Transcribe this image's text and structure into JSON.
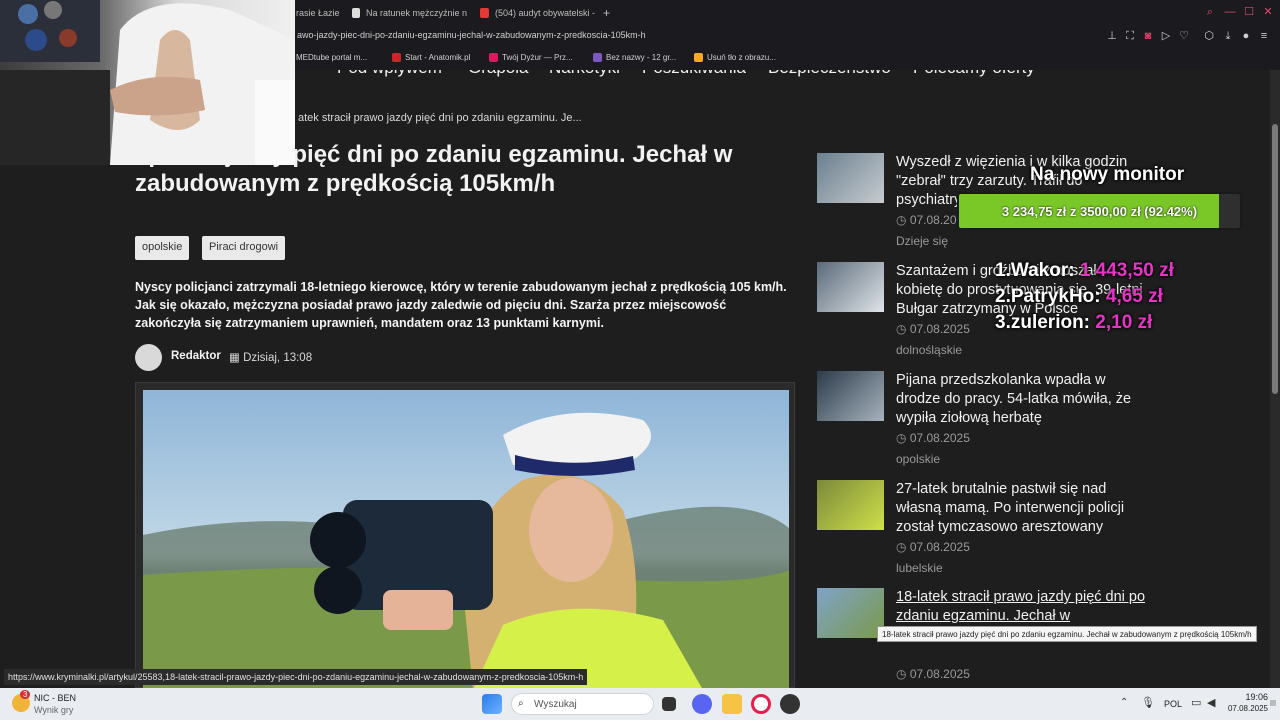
{
  "tabs": [
    {
      "label": "rasie Łazie"
    },
    {
      "label": "Na ratunek mężczyźnie n"
    },
    {
      "label": "(504) audyt obywatelski -"
    }
  ],
  "new_tab": "+",
  "address": {
    "url": "awo-jazdy-piec-dni-po-zdaniu-egzaminu-jechal-w-zabudowanym-z-predkoscia-105km-h"
  },
  "bookmarks": [
    {
      "label": "MEDtube portal m..."
    },
    {
      "label": "Start - Anatomik.pl"
    },
    {
      "label": "Twój Dyżur — Prz..."
    },
    {
      "label": "Bez nazwy - 12 gr..."
    },
    {
      "label": "Usuń tło z obrazu..."
    }
  ],
  "site_nav": [
    "Pod wpływem",
    "Grapola",
    "Narkotyki",
    "Poszukiwania",
    "Bezpieczeństwo",
    "Polecamy oferty"
  ],
  "breadcrumb": "atek stracił prawo jazdy pięć dni po zdaniu egzaminu. Je...",
  "article": {
    "title": "ł prawo jazdy pięć dni po zdaniu egzaminu. Jechał w zabudowanym z prędkością 105km/h",
    "tags": [
      "opolskie",
      "Piraci drogowi"
    ],
    "lead": "Nyscy policjanci zatrzymali 18-letniego kierowcę, który w terenie zabudowanym jechał z prędkością 105 km/h. Jak się okazało, mężczyzna posiadał prawo jazdy zaledwie od pięciu dni. Szarża przez miejscowość zakończyła się zatrzymaniem uprawnień, mandatem oraz 13 punktami karnymi.",
    "author": "Redaktor",
    "date": "Dzisiaj, 13:08"
  },
  "sidebar": [
    {
      "title": "Wyszedł z więzienia i w kilka godzin \"zebrał\" trzy zarzuty. Trafił do psychiatryka | dolnośląskie",
      "date": "07.08.2025",
      "region": "Dzieje się"
    },
    {
      "title": "Szantażem i groźbami zmuszał kobietę do prostytuowania się. 39-letni Bułgar zatrzymany w Polsce",
      "date": "07.08.2025",
      "region": "dolnośląskie"
    },
    {
      "title": "Pijana przedszkolanka wpadła w drodze do pracy. 54-latka mówiła, że wypiła ziołową herbatę",
      "date": "07.08.2025",
      "region": "opolskie"
    },
    {
      "title": "27-latek brutalnie pastwił się nad własną mamą. Po interwencji policji został tymczasowo aresztowany",
      "date": "07.08.2025",
      "region": "lubelskie"
    },
    {
      "title": "18-latek stracił prawo jazdy pięć dni po zdaniu egzaminu. Jechał w zabudowanym z prędkością 105km/h",
      "date": "07.08.2025",
      "region": ""
    }
  ],
  "overlay": {
    "goal_title": "Na nowy monitor",
    "goal_text": "3 234,75 zł  z  3500,00 zł  (92.42%)",
    "goal_progress": 0.9242,
    "leaders": [
      {
        "rank_name": "1.Wakor:",
        "amount": "1 443,50 zł"
      },
      {
        "rank_name": "2.PatrykHo:",
        "amount": "4,65 zł"
      },
      {
        "rank_name": "3.zulerion:",
        "amount": "2,10 zł"
      }
    ],
    "accent_color": "#e733c6",
    "bar_color": "#7ac828"
  },
  "tooltip": "18-latek stracił prawo jazdy pięć dni po zdaniu egzaminu. Jechał w zabudowanym z prędkością 105km/h",
  "status_url": "https://www.kryminalki.pl/artykul/25583,18-latek-stracil-prawo-jazdy-piec-dni-po-zdaniu-egzaminu-jechal-w-zabudowanym-z-predkoscia-105km-h",
  "taskbar": {
    "weather_badge": "3",
    "weather_title": "NIC - BEN",
    "weather_sub": "Wynik gry",
    "search_placeholder": "Wyszukaj",
    "lang": "POL",
    "time": "19:06",
    "date": "07.08.2025"
  }
}
